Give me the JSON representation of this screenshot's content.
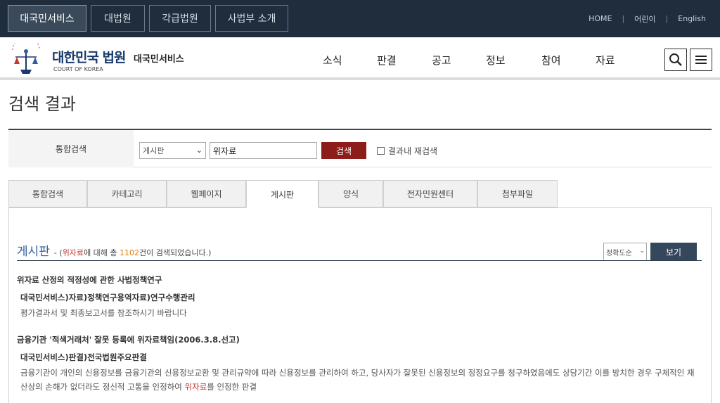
{
  "topbar": {
    "tabs": [
      "대국민서비스",
      "대법원",
      "각급법원",
      "사법부 소개"
    ],
    "links": [
      "HOME",
      "어린이",
      "English"
    ]
  },
  "logo": {
    "title": "대한민국 법원",
    "subtitle": "COURT OF KOREA",
    "service": "대국민서비스"
  },
  "gnb": [
    "소식",
    "판결",
    "공고",
    "정보",
    "참여",
    "자료"
  ],
  "icons": {
    "search": "search-icon",
    "menu": "menu-icon"
  },
  "page": {
    "title": "검색 결과"
  },
  "search": {
    "label": "통합검색",
    "scope_selected": "게시판",
    "query": "위자료",
    "button": "검색",
    "recheck_label": "결과내 재검색"
  },
  "tabs": [
    "통합검색",
    "카테고리",
    "웹페이지",
    "게시판",
    "양식",
    "전자민원센터",
    "첨부파일"
  ],
  "active_tab": "게시판",
  "section": {
    "title": "게시판",
    "dash": " - (",
    "keyword": "위자료",
    "mid": "에 대해 총 ",
    "count": "1102",
    "end": "건이 검색되었습니다.)",
    "sort_selected": "정확도순",
    "view_button": "보기"
  },
  "results": [
    {
      "title": "위자료 산정의 적정성에 관한 사법정책연구",
      "path": "대국민서비스)자료)정책연구용역자료)연구수행관리",
      "desc_pre": "평가결과서 및 최종보고서를 참조하시기 바랍니다",
      "desc_hl": "",
      "desc_post": ""
    },
    {
      "title": "금융기관 '적색거래처' 잘못 등록에 위자료책임(2006.3.8.선고)",
      "path": "대국민서비스)판결)전국법원주요판결",
      "desc_pre": "금융기관이 개인의 신용정보를 금융기관의 신용정보교환 및 관리규약에 따라 신용정보를 관리하여 하고, 당사자가 잘못된 신용정보의 정정요구를 청구하였음에도 상당기간 이를 방치한 경우 구체적인 재산상의 손해가 없더라도 정신적 고통을 인정하여 ",
      "desc_hl": "위자료",
      "desc_post": "를 인정한 판결"
    }
  ],
  "colors": {
    "topbar": "#1f2d3d",
    "brand_red": "#8c1d18",
    "title_blue": "#2e5fa0",
    "view_button": "#35475a"
  }
}
